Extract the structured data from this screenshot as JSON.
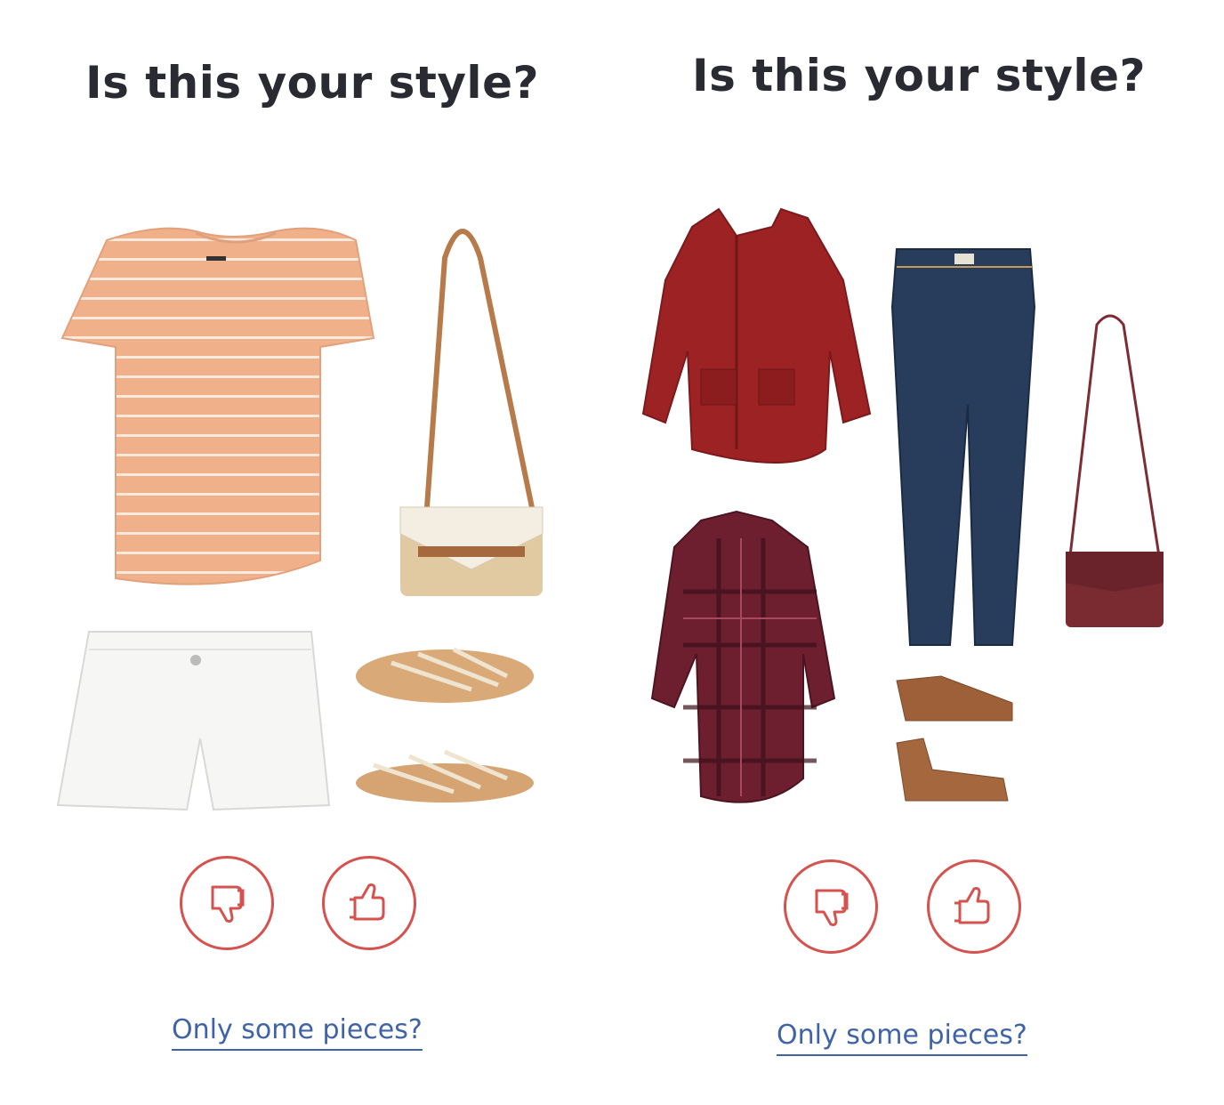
{
  "colors": {
    "title_text": "#2a2a33",
    "button_accent": "#d5524f",
    "link": "#3f63a8"
  },
  "cards": [
    {
      "title": "Is this your style?",
      "dislike_icon": "thumbs-down-icon",
      "like_icon": "thumbs-up-icon",
      "link_text": "Only some pieces?",
      "items": [
        "striped-tee",
        "crossbody-bag",
        "white-shorts",
        "strappy-sandals"
      ]
    },
    {
      "title": "Is this your style?",
      "dislike_icon": "thumbs-down-icon",
      "like_icon": "thumbs-up-icon",
      "link_text": "Only some pieces?",
      "items": [
        "anorak-jacket",
        "skinny-jeans",
        "crossbody-bag",
        "plaid-shirt",
        "ankle-boots"
      ]
    }
  ]
}
